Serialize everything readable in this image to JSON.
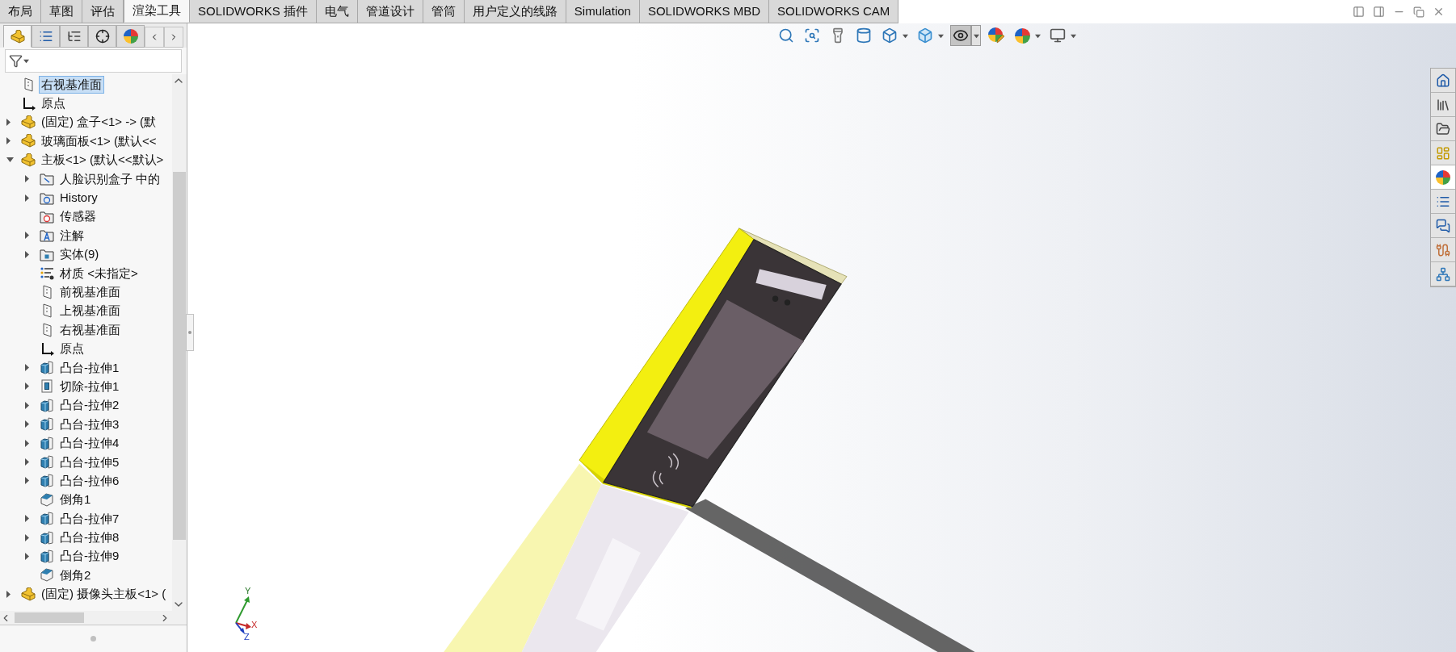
{
  "tabs": [
    {
      "label": "布局",
      "selected": false
    },
    {
      "label": "草图",
      "selected": false
    },
    {
      "label": "评估",
      "selected": false
    },
    {
      "label": "渲染工具",
      "selected": true
    },
    {
      "label": "SOLIDWORKS 插件",
      "selected": false
    },
    {
      "label": "电气",
      "selected": false
    },
    {
      "label": "管道设计",
      "selected": false
    },
    {
      "label": "管筒",
      "selected": false
    },
    {
      "label": "用户定义的线路",
      "selected": false
    },
    {
      "label": "Simulation",
      "selected": false
    },
    {
      "label": "SOLIDWORKS MBD",
      "selected": false
    },
    {
      "label": "SOLIDWORKS CAM",
      "selected": false
    }
  ],
  "panel_tabs": [
    {
      "kind": "feature_tree",
      "selected": true
    },
    {
      "kind": "property",
      "selected": false
    },
    {
      "kind": "configuration",
      "selected": false
    },
    {
      "kind": "dimxpert",
      "selected": false
    },
    {
      "kind": "display",
      "selected": false
    }
  ],
  "tree": [
    {
      "label": "右视基准面",
      "kind": "plane",
      "selected": true
    },
    {
      "label": "原点",
      "kind": "origin",
      "selected": false
    },
    {
      "label": "(固定) 盒子<1> -> (默",
      "kind": "part",
      "expanded": false,
      "selected": false
    },
    {
      "label": "玻璃面板<1> (默认<<",
      "kind": "part",
      "expanded": false,
      "selected": false
    },
    {
      "label": "主板<1> (默认<<默认>",
      "kind": "part",
      "expanded": true,
      "selected": false,
      "children": [
        {
          "label": "人脸识别盒子 中的",
          "kind": "folder_attach",
          "expanded": false,
          "selected": false
        },
        {
          "label": "History",
          "kind": "folder_history",
          "expanded": false,
          "selected": false
        },
        {
          "label": "传感器",
          "kind": "folder_sensor",
          "selected": false
        },
        {
          "label": "注解",
          "kind": "folder_annotation",
          "expanded": false,
          "selected": false
        },
        {
          "label": "实体(9)",
          "kind": "folder_solid",
          "expanded": false,
          "selected": false
        },
        {
          "label": "材质 <未指定>",
          "kind": "material",
          "selected": false
        },
        {
          "label": "前视基准面",
          "kind": "plane",
          "selected": false
        },
        {
          "label": "上视基准面",
          "kind": "plane",
          "selected": false
        },
        {
          "label": "右视基准面",
          "kind": "plane",
          "selected": false
        },
        {
          "label": "原点",
          "kind": "origin",
          "selected": false
        },
        {
          "label": "凸台-拉伸1",
          "kind": "boss",
          "expanded": false,
          "selected": false
        },
        {
          "label": "切除-拉伸1",
          "kind": "cut",
          "expanded": false,
          "selected": false
        },
        {
          "label": "凸台-拉伸2",
          "kind": "boss",
          "expanded": false,
          "selected": false
        },
        {
          "label": "凸台-拉伸3",
          "kind": "boss",
          "expanded": false,
          "selected": false
        },
        {
          "label": "凸台-拉伸4",
          "kind": "boss",
          "expanded": false,
          "selected": false
        },
        {
          "label": "凸台-拉伸5",
          "kind": "boss",
          "expanded": false,
          "selected": false
        },
        {
          "label": "凸台-拉伸6",
          "kind": "boss",
          "expanded": false,
          "selected": false
        },
        {
          "label": "倒角1",
          "kind": "chamfer",
          "selected": false
        },
        {
          "label": "凸台-拉伸7",
          "kind": "boss",
          "expanded": false,
          "selected": false
        },
        {
          "label": "凸台-拉伸8",
          "kind": "boss",
          "expanded": false,
          "selected": false
        },
        {
          "label": "凸台-拉伸9",
          "kind": "boss",
          "expanded": false,
          "selected": false
        },
        {
          "label": "倒角2",
          "kind": "chamfer",
          "selected": false
        }
      ]
    },
    {
      "label": "(固定) 摄像头主板<1> (",
      "kind": "part",
      "expanded": false,
      "selected": false
    }
  ],
  "view_toolbar": [
    {
      "kind": "zoom_fit",
      "selected": false,
      "dropdown": false
    },
    {
      "kind": "zoom_area",
      "selected": false,
      "dropdown": false
    },
    {
      "kind": "previous_view",
      "selected": false,
      "dropdown": false
    },
    {
      "kind": "section_view",
      "selected": false,
      "dropdown": false
    },
    {
      "kind": "view_orientation",
      "selected": false,
      "dropdown": true
    },
    {
      "kind": "display_style",
      "selected": false,
      "dropdown": true
    },
    {
      "kind": "hide_show",
      "selected": true,
      "dropdown": true
    },
    {
      "kind": "edit_appearance",
      "selected": false,
      "dropdown": false
    },
    {
      "kind": "apply_scene",
      "selected": false,
      "dropdown": true
    },
    {
      "kind": "view_settings",
      "selected": false,
      "dropdown": true
    }
  ],
  "task_pane": [
    {
      "kind": "home",
      "selected": false
    },
    {
      "kind": "library",
      "selected": false
    },
    {
      "kind": "explorer",
      "selected": false
    },
    {
      "kind": "palette",
      "selected": false
    },
    {
      "kind": "appearances",
      "selected": true
    },
    {
      "kind": "properties",
      "selected": false
    },
    {
      "kind": "forum",
      "selected": false
    },
    {
      "kind": "routing",
      "selected": false
    },
    {
      "kind": "electrical",
      "selected": false
    }
  ],
  "triad": {
    "y_label": "Y",
    "x_label": "X",
    "z_label": "Z"
  }
}
